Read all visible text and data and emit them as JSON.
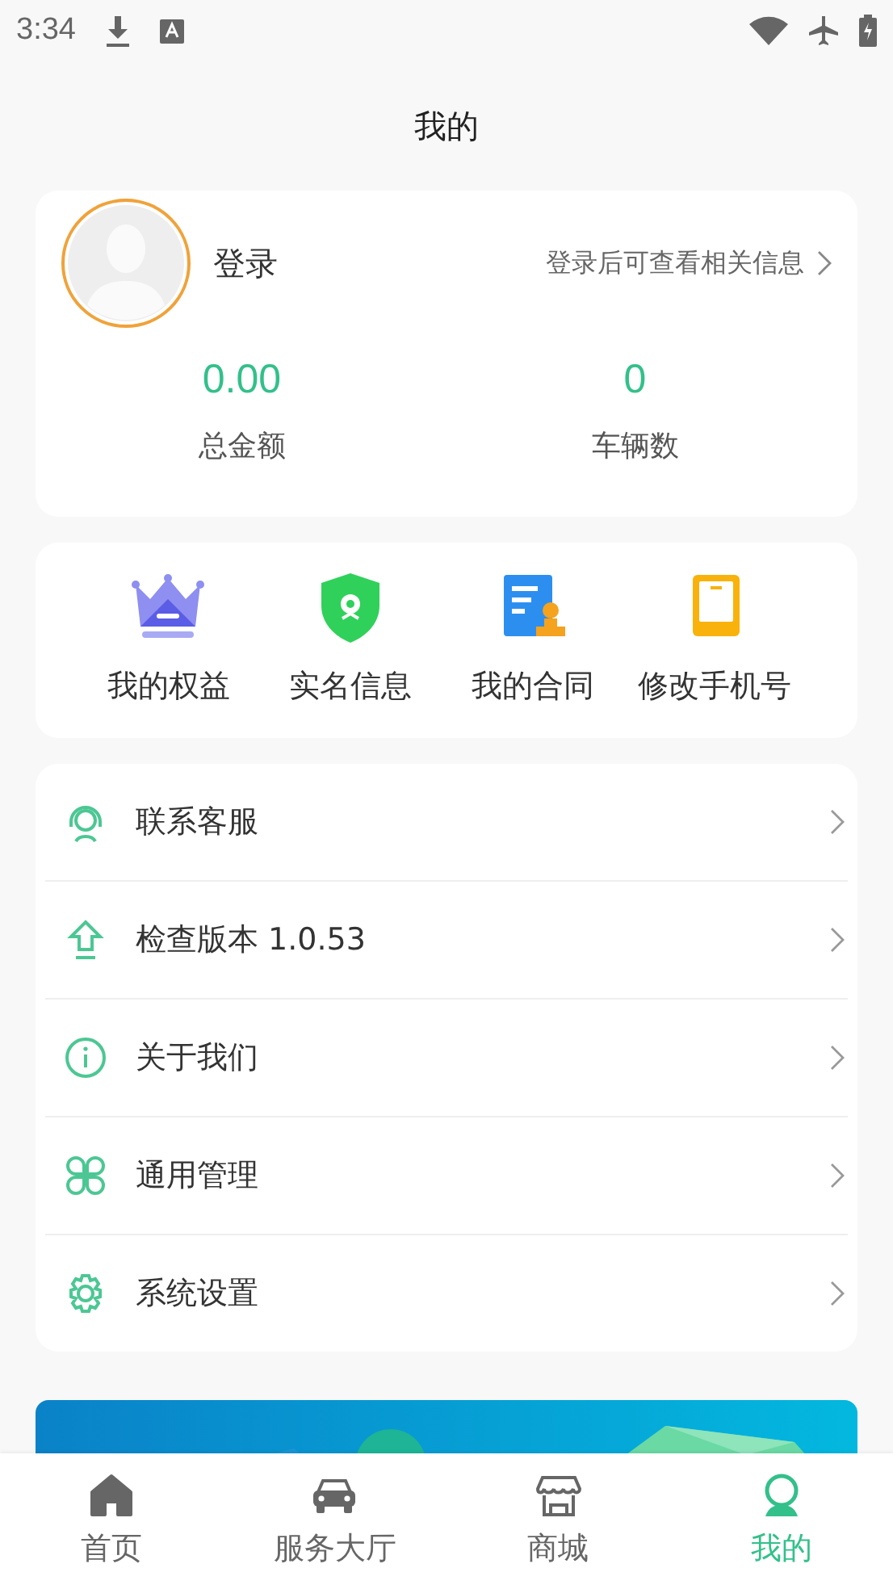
{
  "status_bar": {
    "time": "3:34"
  },
  "header": {
    "title": "我的"
  },
  "profile": {
    "login": "登录",
    "hint": "登录后可查看相关信息",
    "stats": [
      {
        "value": "0.00",
        "label": "总金额"
      },
      {
        "value": "0",
        "label": "车辆数"
      }
    ]
  },
  "shortcuts": [
    {
      "kind": "crown",
      "label": "我的权益"
    },
    {
      "kind": "shield",
      "label": "实名信息"
    },
    {
      "kind": "contract",
      "label": "我的合同"
    },
    {
      "kind": "phone",
      "label": "修改手机号"
    }
  ],
  "menu": [
    {
      "kind": "support",
      "label": "联系客服"
    },
    {
      "kind": "upload",
      "label": "检查版本 1.0.53"
    },
    {
      "kind": "info",
      "label": "关于我们"
    },
    {
      "kind": "grid",
      "label": "通用管理"
    },
    {
      "kind": "gear",
      "label": "系统设置"
    }
  ],
  "tabs": [
    {
      "kind": "home",
      "label": "首页",
      "selected": false
    },
    {
      "kind": "car",
      "label": "服务大厅",
      "selected": false
    },
    {
      "kind": "shop",
      "label": "商城",
      "selected": false
    },
    {
      "kind": "user",
      "label": "我的",
      "selected": true
    }
  ]
}
